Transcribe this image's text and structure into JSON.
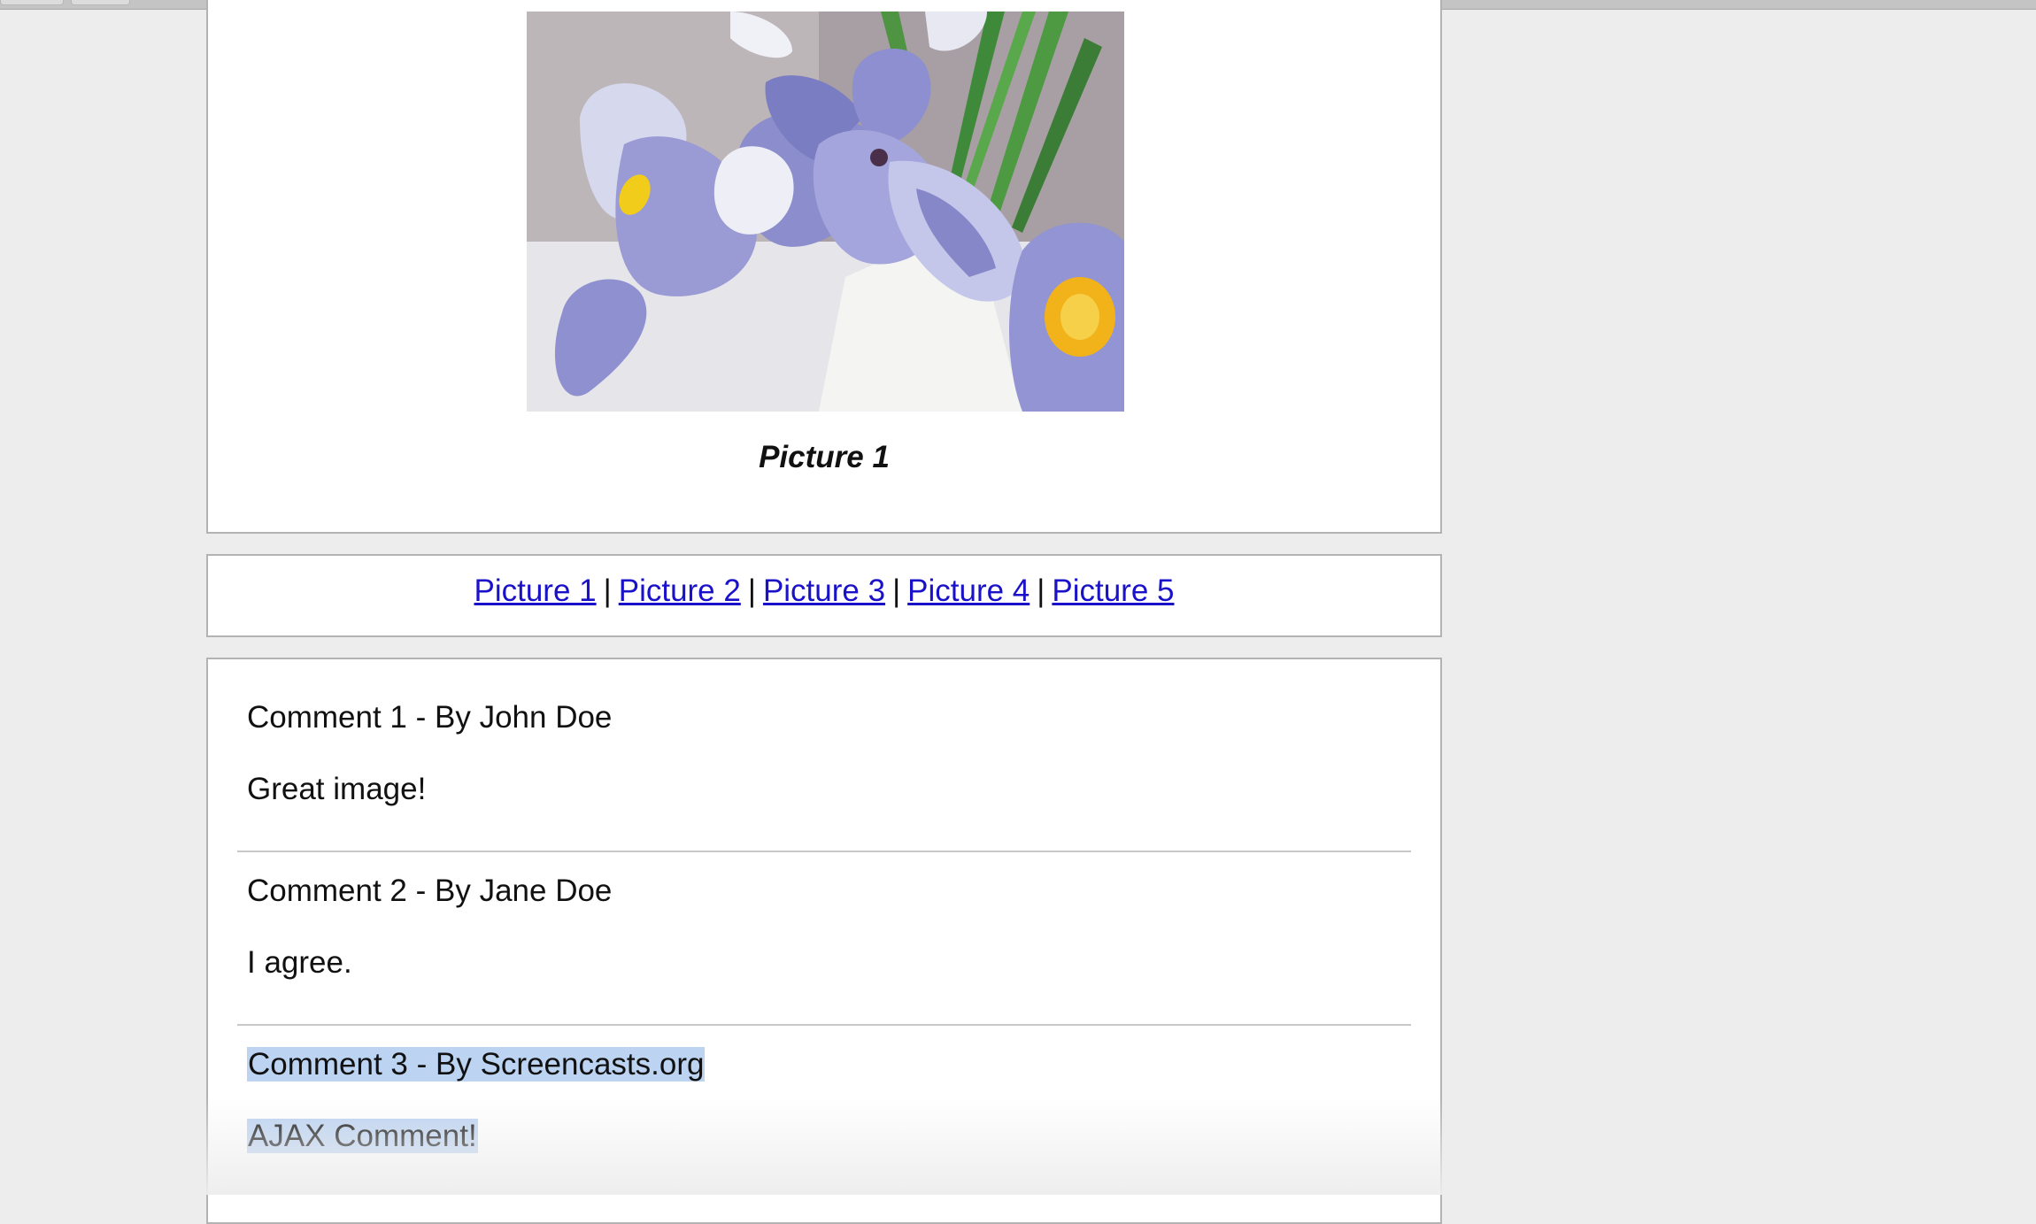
{
  "picture": {
    "caption": "Picture 1",
    "image_subject": "iris-flower-photo"
  },
  "nav": {
    "links": [
      "Picture 1",
      "Picture 2",
      "Picture 3",
      "Picture 4",
      "Picture 5"
    ],
    "separator": "|"
  },
  "comments": [
    {
      "title": "Comment 1 - By John Doe",
      "body": "Great image!"
    },
    {
      "title": "Comment 2 - By Jane Doe",
      "body": "I agree."
    },
    {
      "title": "Comment 3 - By Screencasts.org",
      "body": "AJAX Comment!"
    }
  ],
  "colors": {
    "link": "#1a12c9",
    "selection": "#bcd3f2",
    "page_background": "#ededed",
    "box_border": "#b3b3b3"
  }
}
